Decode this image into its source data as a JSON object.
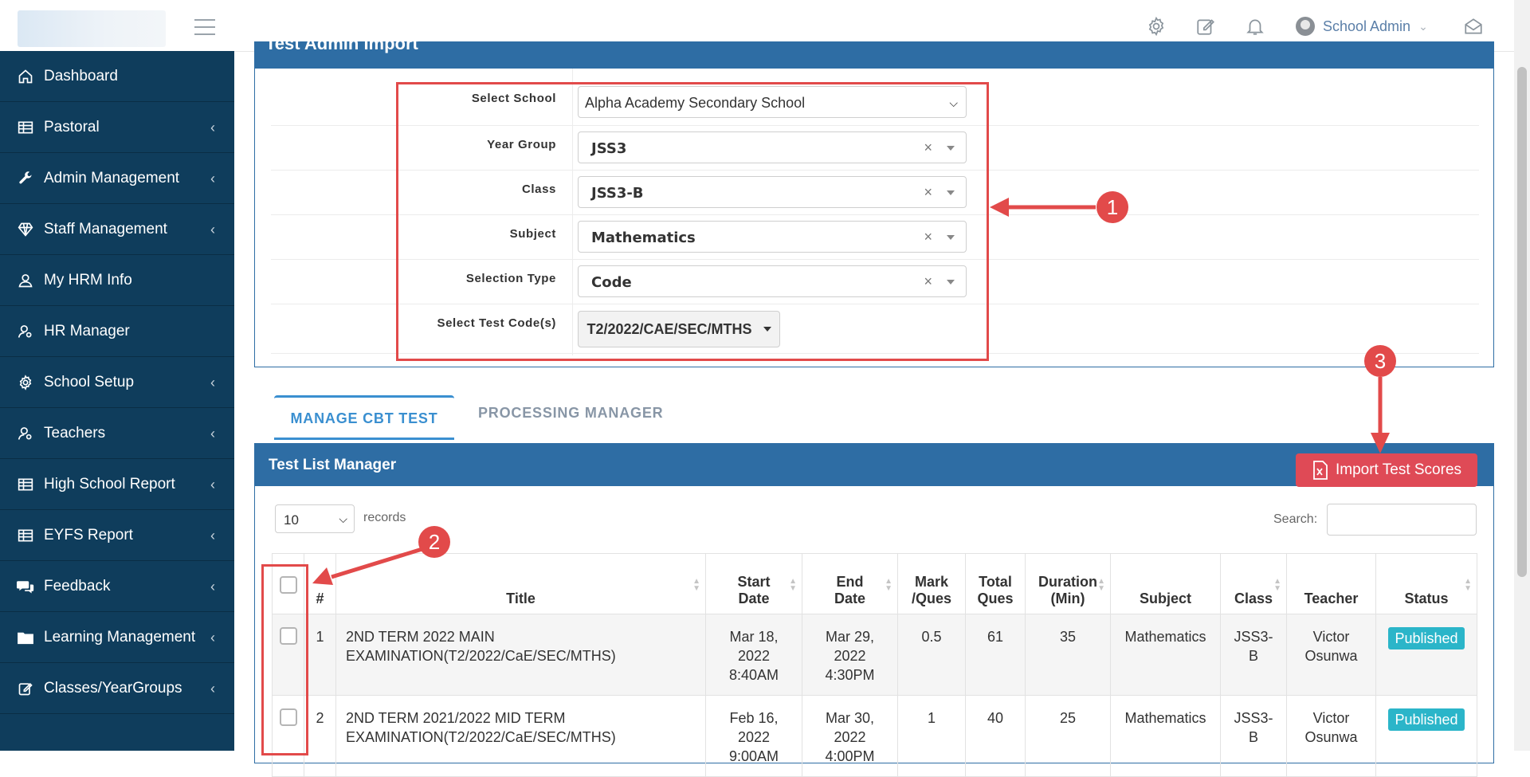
{
  "topbar": {
    "user_name": "School Admin",
    "icons": [
      "gear-icon",
      "edit-icon",
      "bell-icon",
      "user-icon",
      "chevron-down-icon",
      "envelope-open-icon"
    ]
  },
  "sidebar": {
    "items": [
      {
        "label": "Dashboard",
        "icon": "home-icon",
        "has_chevron": false
      },
      {
        "label": "Pastoral",
        "icon": "table-icon",
        "has_chevron": true
      },
      {
        "label": "Admin Management",
        "icon": "wrench-icon",
        "has_chevron": true
      },
      {
        "label": "Staff Management",
        "icon": "diamond-icon",
        "has_chevron": true
      },
      {
        "label": "My HRM Info",
        "icon": "user-icon",
        "has_chevron": false
      },
      {
        "label": "HR Manager",
        "icon": "user-gear-icon",
        "has_chevron": false
      },
      {
        "label": "School Setup",
        "icon": "gear-icon",
        "has_chevron": true
      },
      {
        "label": "Teachers",
        "icon": "user-gear-icon",
        "has_chevron": true
      },
      {
        "label": "High School Report",
        "icon": "table-icon",
        "has_chevron": true
      },
      {
        "label": "EYFS Report",
        "icon": "table-icon",
        "has_chevron": true
      },
      {
        "label": "Feedback",
        "icon": "comments-icon",
        "has_chevron": true
      },
      {
        "label": "Learning Management",
        "icon": "folder-icon",
        "has_chevron": true
      },
      {
        "label": "Classes/YearGroups",
        "icon": "edit-icon",
        "has_chevron": true
      }
    ]
  },
  "import_panel": {
    "title": "Test Admin Import",
    "fields": {
      "school": {
        "label": "Select School",
        "value": "Alpha Academy Secondary School"
      },
      "year_group": {
        "label": "Year Group",
        "value": "JSS3"
      },
      "class": {
        "label": "Class",
        "value": "JSS3-B"
      },
      "subject": {
        "label": "Subject",
        "value": "Mathematics"
      },
      "selection_type": {
        "label": "Selection Type",
        "value": "Code"
      },
      "test_codes": {
        "label": "Select Test Code(s)",
        "value": "T2/2022/CAE/SEC/MTHS"
      }
    }
  },
  "tabs": {
    "manage": "MANAGE CBT TEST",
    "processing": "PROCESSING MANAGER"
  },
  "test_list": {
    "title": "Test List Manager",
    "import_button": "Import Test Scores",
    "records_value": "10",
    "records_label": "records",
    "search_label": "Search:",
    "headers": {
      "num": "#",
      "title": "Title",
      "start_1": "Start",
      "start_2": "Date",
      "end_1": "End",
      "end_2": "Date",
      "mark_1": "Mark",
      "mark_2": "/Ques",
      "total_1": "Total",
      "total_2": "Ques",
      "duration_1": "Duration",
      "duration_2": "(Min)",
      "subject": "Subject",
      "class": "Class",
      "teacher": "Teacher",
      "status": "Status"
    },
    "rows": [
      {
        "num": "1",
        "title_1": "2ND TERM 2022 MAIN",
        "title_2": "EXAMINATION(T2/2022/CaE/SEC/MTHS)",
        "start_1": "Mar 18,",
        "start_2": "2022",
        "start_3": "8:40AM",
        "end_1": "Mar 29,",
        "end_2": "2022",
        "end_3": "4:30PM",
        "mark": "0.5",
        "total": "61",
        "duration": "35",
        "subject": "Mathematics",
        "class_1": "JSS3-",
        "class_2": "B",
        "teacher_1": "Victor",
        "teacher_2": "Osunwa",
        "status": "Published"
      },
      {
        "num": "2",
        "title_1": "2ND TERM 2021/2022 MID TERM",
        "title_2": "EXAMINATION(T2/2022/CaE/SEC/MTHS)",
        "start_1": "Feb 16,",
        "start_2": "2022",
        "start_3": "9:00AM",
        "end_1": "Mar 30,",
        "end_2": "2022",
        "end_3": "4:00PM",
        "mark": "1",
        "total": "40",
        "duration": "25",
        "subject": "Mathematics",
        "class_1": "JSS3-",
        "class_2": "B",
        "teacher_1": "Victor",
        "teacher_2": "Osunwa",
        "status": "Published"
      }
    ]
  },
  "annotations": {
    "step1": "1",
    "step2": "2",
    "step3": "3",
    "color": "#e24a4a"
  },
  "colors": {
    "sidebar_bg": "#0f3d5c",
    "panel_header": "#2e6da4",
    "import_button": "#df4a56",
    "badge": "#2bb5c9",
    "tab_active": "#3a8fd0"
  }
}
